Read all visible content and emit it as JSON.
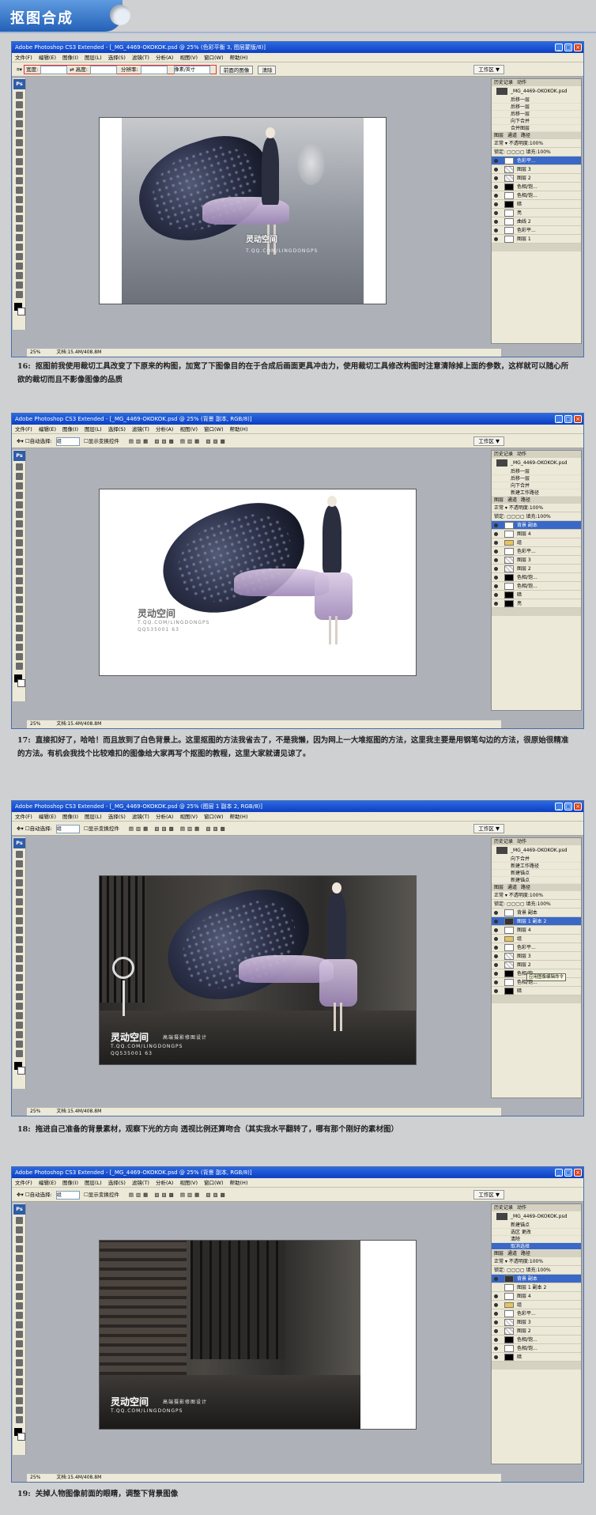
{
  "header": {
    "title": "抠图合成"
  },
  "menu": [
    "文件(F)",
    "编辑(E)",
    "图像(I)",
    "图层(L)",
    "选择(S)",
    "滤镜(T)",
    "分析(A)",
    "视图(V)",
    "窗口(W)",
    "帮助(H)"
  ],
  "workspace_label": "工作区 ▼",
  "screens": [
    {
      "title": "Adobe Photoshop CS3 Extended - [_MG_4469-OKOKOK.psd @ 25% (色彩平衡 3, 图层蒙版/8)]",
      "options": {
        "width_label": "宽度:",
        "height_label": "高度:",
        "res_label": "分辨率:",
        "unit": "像素/英寸",
        "front_btn": "前面的图像",
        "clear_btn": "清除"
      },
      "status": {
        "zoom": "25%",
        "doc": "文档:15.4M/408.8M"
      },
      "history": [
        "_MG_4469-OKOKOK.psd",
        "后移一层",
        "后移一层",
        "后移一层",
        "向下合并",
        "合并图层"
      ],
      "layers": [
        "色彩平...",
        "图层 3",
        "图层 2",
        "色相/饱...",
        "色相/饱...",
        "暗",
        "亮",
        "曲线 2",
        "色彩平...",
        "图层 1"
      ],
      "caption_num": "16:",
      "caption": "抠图前我使用裁切工具改变了下原来的构图，加宽了下图像目的在于合成后画面更具冲击力，使用裁切工具修改构图时注意清除掉上面的参数，这样就可以随心所欲的裁切而且不影像图像的品质"
    },
    {
      "title": "Adobe Photoshop CS3 Extended - [_MG_4469-OKOKOK.psd @ 25% (背景 副本, RGB/8)]",
      "options": {
        "auto_select": "自动选择:",
        "group": "组",
        "show_transform": "显示变换控件"
      },
      "status": {
        "zoom": "25%",
        "doc": "文档:15.4M/408.8M"
      },
      "history": [
        "_MG_4469-OKOKOK.psd",
        "后移一层",
        "后移一层",
        "向下合并",
        "新建工作路径"
      ],
      "layers": [
        "背景 副本",
        "图层 4",
        "组",
        "色彩平...",
        "图层 3",
        "图层 2",
        "色相/饱...",
        "色相/饱...",
        "暗",
        "亮"
      ],
      "caption_num": "17:",
      "caption": "直接扣好了，哈哈！而且放到了白色背景上。这里抠图的方法我省去了，不是我懒，因为网上一大堆抠图的方法，这里我主要是用钢笔勾边的方法，很原始很精准的方法。有机会我找个比较难扣的图像给大家再写个抠图的教程，这里大家就请见谅了。"
    },
    {
      "title": "Adobe Photoshop CS3 Extended - [_MG_4469-OKOKOK.psd @ 25% (图层 1 副本 2, RGB/8)]",
      "options": {
        "auto_select": "自动选择:",
        "group": "组",
        "show_transform": "显示变换控件"
      },
      "status": {
        "zoom": "25%",
        "doc": "文档:15.4M/408.8M"
      },
      "history": [
        "_MG_4469-OKOKOK.psd",
        "向下合并",
        "新建工作路径",
        "新建锚点",
        "新建锚点"
      ],
      "layers": [
        "背景 副本",
        "图层 1 副本 2",
        "图层 4",
        "组",
        "色彩平...",
        "图层 3",
        "图层 2",
        "色相/饱...",
        "色相/饱...",
        "暗"
      ],
      "tooltip": "应用图像编辑命令",
      "caption_num": "18:",
      "caption": "拖进自己准备的背景素材，观察下光的方向 透视比例还算吻合（其实我水平翻转了，哪有那个刚好的素材图）"
    },
    {
      "title": "Adobe Photoshop CS3 Extended - [_MG_4469-OKOKOK.psd @ 25% (背景 副本, RGB/8)]",
      "options": {
        "auto_select": "自动选择:",
        "group": "组",
        "show_transform": "显示变换控件"
      },
      "status": {
        "zoom": "25%",
        "doc": "文档:15.4M/408.8M"
      },
      "history": [
        "_MG_4469-OKOKOK.psd",
        "新建锚点",
        "选区 更改",
        "清除",
        "取消选择"
      ],
      "layers": [
        "背景 副本",
        "图层 1 副本 2",
        "图层 4",
        "组",
        "色彩平...",
        "图层 3",
        "图层 2",
        "色相/饱...",
        "色相/饱...",
        "暗"
      ],
      "caption_num": "19:",
      "caption": "关掉人物图像前面的眼睛，调整下背景图像"
    }
  ],
  "panel": {
    "history_tab": "历史记录",
    "actions_tab": "动作",
    "layers_tab": "图层",
    "channels_tab": "通道",
    "paths_tab": "路径",
    "blend": "正常",
    "opacity_label": "不透明度:",
    "opacity": "100%",
    "lock_label": "锁定:",
    "fill_label": "填充:",
    "fill": "100%"
  },
  "watermark": {
    "logo": "灵动空间",
    "sub": "高端摄影修图设计",
    "url": "T.QQ.COM/LINGDONGPS",
    "qq": "QQ535001 63"
  }
}
